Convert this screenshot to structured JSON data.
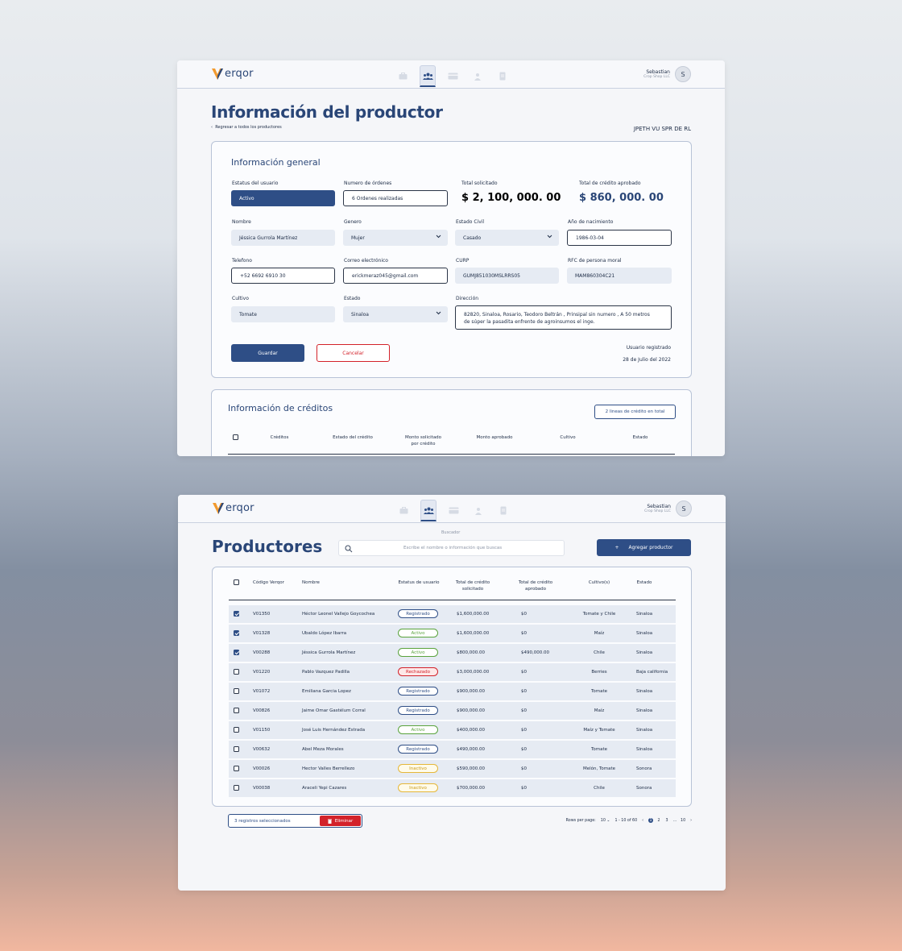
{
  "app": {
    "logo_text": "erqor",
    "user_name": "Sebastian",
    "user_org": "Crop Shop LLC",
    "avatar_initial": "S",
    "accent": "#2e4e86",
    "nav_icons": [
      "briefcase-icon",
      "users-icon",
      "credit-card-icon",
      "person-icon",
      "document-icon"
    ]
  },
  "detail": {
    "title": "Información del productor",
    "back_link": "Regresar a todos los productores",
    "company": "JPETH VU SPR DE RL",
    "general_title": "Información general",
    "fields": {
      "status_label": "Estatus del usuario",
      "status_value": "Activo",
      "orders_label": "Numero de órdenes",
      "orders_value": "6 Ordenes realizadas",
      "total_req_label": "Total solicitado",
      "total_req_value": "$ 2, 100, 000. 00",
      "total_appr_label": "Total  de crédito aprobado",
      "total_appr_value": "$ 860, 000. 00",
      "name_label": "Nombre",
      "name_value": "Jéssica Gurrola Martínez",
      "gender_label": "Genero",
      "gender_value": "Mujer",
      "civil_label": "Estado Civil",
      "civil_value": "Casado",
      "birth_label": "Año de nacimiento",
      "birth_value": "1986-03-04",
      "phone_label": "Telefono",
      "phone_value": "+52 6692 6910 30",
      "email_label": "Correo electrónico",
      "email_value": "erickmeraz045@gmail.com",
      "curp_label": "CURP",
      "curp_value": "GUMJ851030MSLRRS05",
      "rfc_label": "RFC de persona moral",
      "rfc_value": "MAM860304C21",
      "crop_label": "Cultivo",
      "crop_value": "Tomate",
      "state_label": "Estado",
      "state_value": "Sinaloa",
      "address_label": "Dirección",
      "address_line1": "82820, Sinaloa, Rosario, Teodoro Beltrán , Prinsipal sin numero , A 50 metros",
      "address_line2": "de súper la pasadita enfrente de agroinsumos el inge."
    },
    "save_label": "Guardar",
    "cancel_label": "Cancelar",
    "registered_label": "Usuario registrado",
    "registered_date": "28 de Julio del 2022",
    "credits_title": "Información de créditos",
    "credits_badge": "2 lineas de crédito en total",
    "credit_headers": [
      "Créditos",
      "Estado del crédito",
      "Monto solicitado",
      "por crédito",
      "Monto aprobado",
      "Cultivo",
      "Estado"
    ]
  },
  "list": {
    "search_label": "Buscador",
    "title": "Productores",
    "search_placeholder": "Escribe el nombre o información que buscas",
    "add_label": "Agregar productor",
    "headers": [
      "Código Verqor",
      "Nombre",
      "Estatus de usuario",
      "Total de crédito",
      "solicitado",
      "Total de crédito",
      "aprobado",
      "Cultivo(s)",
      "Estado"
    ],
    "rows": [
      {
        "checked": true,
        "code": "V01350",
        "name": "Héctor Leonel Vallejo Goycochea",
        "status": "Registrado",
        "requested": "$1,600,000.00",
        "approved": "$0",
        "crops": "Tomate y Chile",
        "state": "Sinaloa"
      },
      {
        "checked": true,
        "code": "V01328",
        "name": "Ubaldo López Ibarra",
        "status": "Activo",
        "requested": "$1,600,000.00",
        "approved": "$0",
        "crops": "Maíz",
        "state": "Sinaloa"
      },
      {
        "checked": true,
        "code": "V00288",
        "name": "Jéssica Gurrola Martínez",
        "status": "Activo",
        "requested": "$800,000.00",
        "approved": "$490,000.00",
        "crops": "Chile",
        "state": "Sinaloa"
      },
      {
        "checked": false,
        "code": "V01220",
        "name": "Pablo Vazquez Padilla",
        "status": "Rechazado",
        "requested": "$3,000,000.00",
        "approved": "$0",
        "crops": "Berries",
        "state": "Baja california"
      },
      {
        "checked": false,
        "code": "V01072",
        "name": "Emiliana Garcia Lopez",
        "status": "Registrado",
        "requested": "$900,000.00",
        "approved": "$0",
        "crops": "Tomate",
        "state": "Sinaloa"
      },
      {
        "checked": false,
        "code": "V00826",
        "name": "Jaime Omar Gastélum Corral",
        "status": "Registrado",
        "requested": "$900,000.00",
        "approved": "$0",
        "crops": "Maíz",
        "state": "Sinaloa"
      },
      {
        "checked": false,
        "code": "V01150",
        "name": "José Luis Hernández Estrada",
        "status": "Activo",
        "requested": "$400,000.00",
        "approved": "$0",
        "crops": "Maíz y Tomate",
        "state": "Sinaloa"
      },
      {
        "checked": false,
        "code": "V00632",
        "name": "Abel Meza Morales",
        "status": "Registrado",
        "requested": "$490,000.00",
        "approved": "$0",
        "crops": "Tomate",
        "state": "Sinaloa"
      },
      {
        "checked": false,
        "code": "V00026",
        "name": "Hector Valles Berrellezo",
        "status": "Inactivo",
        "requested": "$590,000.00",
        "approved": "$0",
        "crops": "Melón, Tomate",
        "state": "Sonora"
      },
      {
        "checked": false,
        "code": "V00038",
        "name": "Araceli Yepi Cazares",
        "status": "Inactivo",
        "requested": "$700,000.00",
        "approved": "$0",
        "crops": "Chile",
        "state": "Sonora"
      }
    ],
    "selected_text": "3 registros seleccionados",
    "delete_label": "Eliminar",
    "rows_per_page_label": "Rows per page:",
    "rows_per_page_value": "10",
    "range_text": "1 - 10 of 60",
    "pages": [
      "1",
      "2",
      "3",
      "...",
      "10"
    ],
    "current_page": "1"
  }
}
